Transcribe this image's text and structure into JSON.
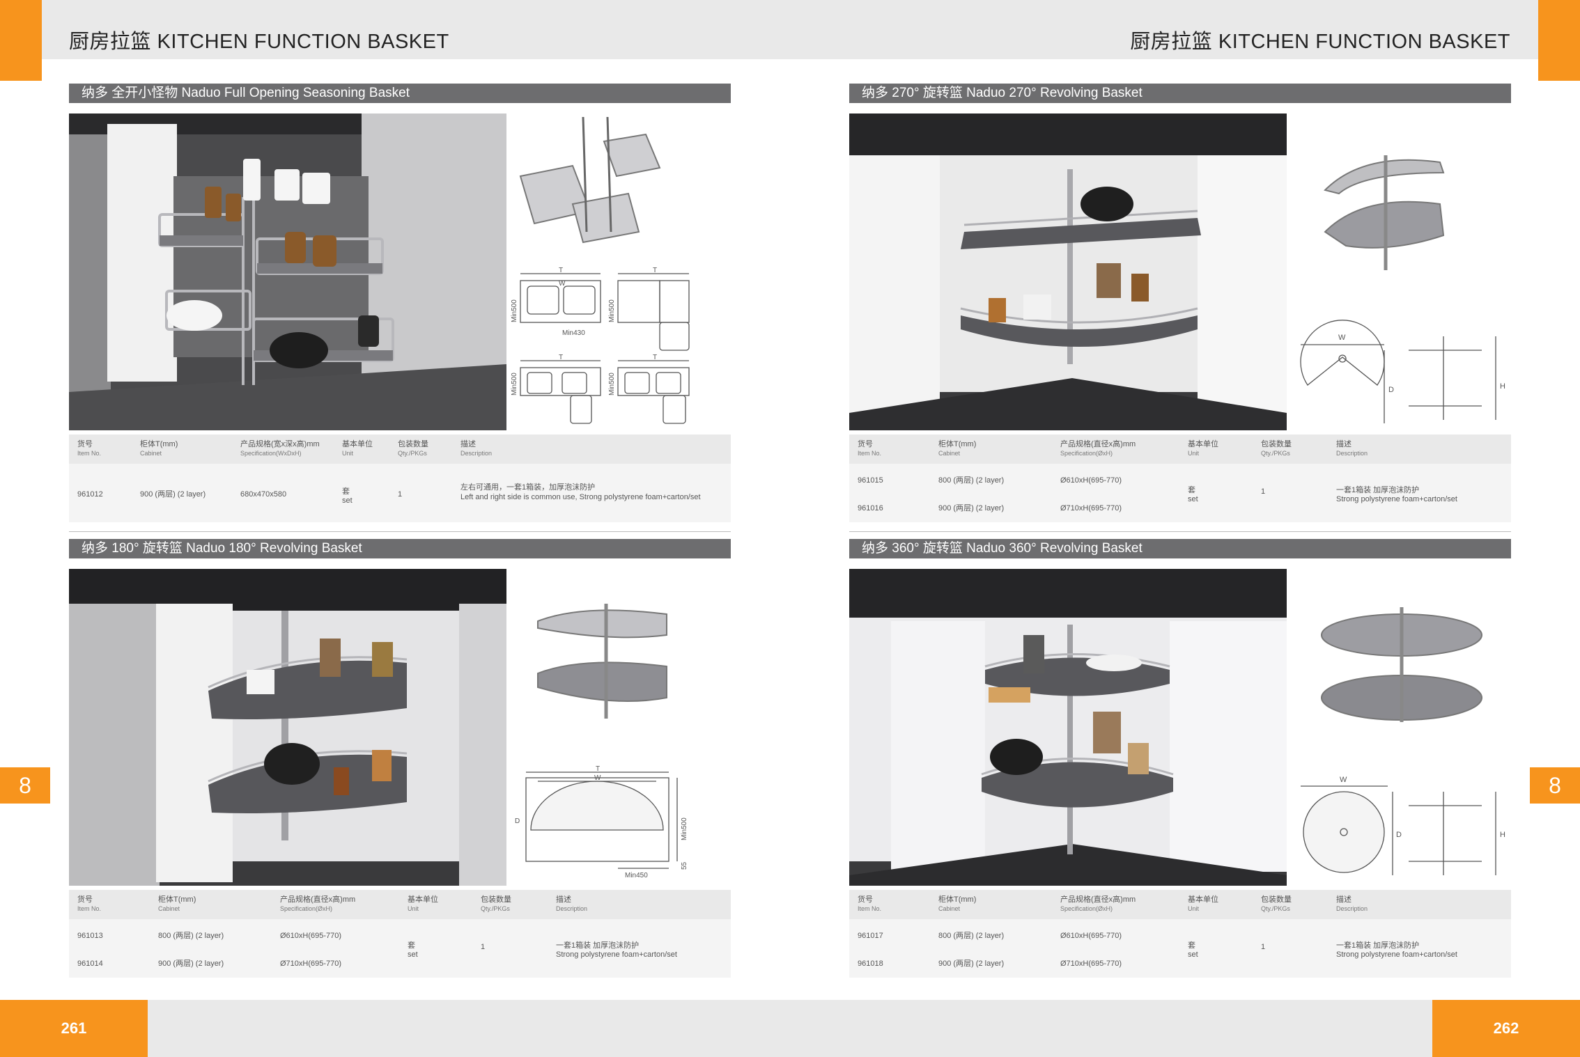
{
  "header": {
    "left_title": "厨房拉篮  KITCHEN FUNCTION BASKET",
    "right_title": "厨房拉篮  KITCHEN FUNCTION BASKET"
  },
  "chapter_tab": {
    "left": "8",
    "right": "8"
  },
  "page_numbers": {
    "left": "261",
    "right": "262"
  },
  "colors": {
    "accent": "#f7941d",
    "section_bar": "#6d6d6f",
    "band": "#e9e9e9"
  },
  "table_headers": {
    "item_no": "货号",
    "item_no_en": "Item No.",
    "cabinet": "柜体T(mm)",
    "cabinet_en": "Cabinet",
    "spec_wdh": "产品规格(宽x深x高)mm",
    "spec_wdh_en": "Specification(WxDxH)",
    "spec_round": "产品规格(直径x高)mm",
    "spec_round_en": "Specification(ØxH)",
    "unit": "基本单位",
    "unit_en": "Unit",
    "qty": "包装数量",
    "qty_en": "Qty./PKGs",
    "desc": "描述",
    "desc_en": "Description"
  },
  "sections": {
    "full_opening": {
      "title": "纳多  全开小怪物    Naduo Full Opening Seasoning Basket",
      "dims": {
        "t": "T",
        "w": "W",
        "min500": "Min500",
        "min430": "Min430"
      },
      "rows": [
        {
          "item": "961012",
          "cabinet": "900 (两层)  (2 layer)",
          "spec": "680x470x580"
        }
      ],
      "unit_cn": "套",
      "unit_en": "set",
      "qty": "1",
      "desc_cn": "左右可通用，一套1箱装，加厚泡沫防护",
      "desc_en": "Left and right side is common use, Strong polystyrene foam+carton/set"
    },
    "rev270": {
      "title": "纳多  270°  旋转篮    Naduo 270°  Revolving Basket",
      "dims": {
        "w": "W",
        "d": "D",
        "h": "H"
      },
      "rows": [
        {
          "item": "961015",
          "cabinet": "800 (两层)  (2 layer)",
          "spec": "Ø610xH(695-770)"
        },
        {
          "item": "961016",
          "cabinet": "900 (两层)  (2 layer)",
          "spec": "Ø710xH(695-770)"
        }
      ],
      "unit_cn": "套",
      "unit_en": "set",
      "qty": "1",
      "desc_cn": "一套1箱装 加厚泡沫防护",
      "desc_en": "Strong polystyrene foam+carton/set"
    },
    "rev180": {
      "title": "纳多  180°  旋转篮    Naduo 180°  Revolving Basket",
      "dims": {
        "t": "T",
        "w": "W",
        "d": "D",
        "min500": "Min500",
        "min450": "Min450",
        "n55": "55"
      },
      "rows": [
        {
          "item": "961013",
          "cabinet": "800 (两层)  (2 layer)",
          "spec": "Ø610xH(695-770)"
        },
        {
          "item": "961014",
          "cabinet": "900 (两层)  (2 layer)",
          "spec": "Ø710xH(695-770)"
        }
      ],
      "unit_cn": "套",
      "unit_en": "set",
      "qty": "1",
      "desc_cn": "一套1箱装 加厚泡沫防护",
      "desc_en": "Strong polystyrene foam+carton/set"
    },
    "rev360": {
      "title": "纳多  360°  旋转篮    Naduo 360°  Revolving Basket",
      "dims": {
        "w": "W",
        "d": "D",
        "h": "H"
      },
      "rows": [
        {
          "item": "961017",
          "cabinet": "800 (两层)  (2 layer)",
          "spec": "Ø610xH(695-770)"
        },
        {
          "item": "961018",
          "cabinet": "900 (两层)  (2 layer)",
          "spec": "Ø710xH(695-770)"
        }
      ],
      "unit_cn": "套",
      "unit_en": "set",
      "qty": "1",
      "desc_cn": "一套1箱装 加厚泡沫防护",
      "desc_en": "Strong polystyrene foam+carton/set"
    }
  }
}
